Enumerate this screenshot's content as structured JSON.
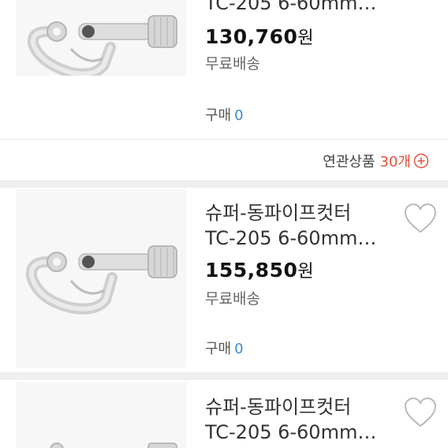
{
  "products": [
    {
      "title_line1": "",
      "title_line2": "TC-205 6-60mm…",
      "price": "130,760",
      "currency": "원",
      "shipping": "무료배송",
      "buy_label": "구매",
      "buy_count": "0"
    },
    {
      "title_line1": "슈퍼-동파이프컷터",
      "title_line2": "TC-205 6-60mm…",
      "price": "155,850",
      "currency": "원",
      "shipping": "무료배송",
      "buy_label": "구매",
      "buy_count": "0"
    },
    {
      "title_line1": "슈퍼-동파이프컷터",
      "title_line2": "TC-205 6-60mm…"
    }
  ],
  "related": {
    "label": "연관상품",
    "count": "30개"
  },
  "icons": {
    "wishlist": "heart-outline-icon",
    "expand": "plus-circle-icon",
    "product_image": "pipe-cutter-image"
  },
  "colors": {
    "accent_blue": "#3a8bd8",
    "accent_red": "#e0533e",
    "divider": "#efefef"
  }
}
